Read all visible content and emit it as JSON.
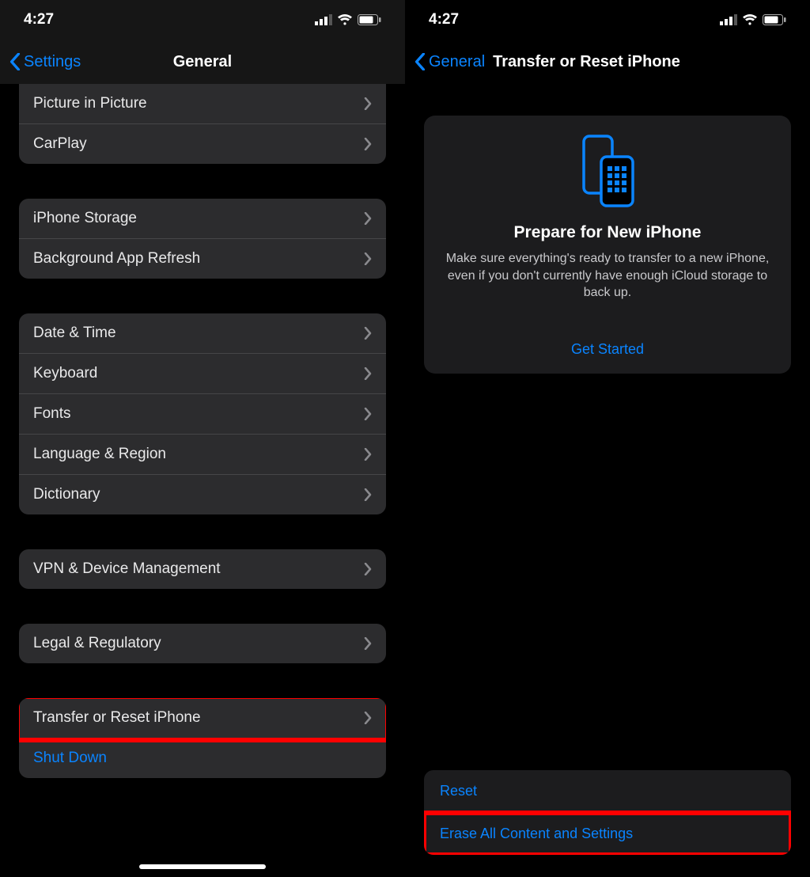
{
  "colors": {
    "accent": "#0a84ff",
    "highlight": "#ff0000"
  },
  "left": {
    "status": {
      "time": "4:27"
    },
    "nav": {
      "back": "Settings",
      "title": "General"
    },
    "groups": [
      {
        "rows": [
          {
            "label": "Picture in Picture"
          },
          {
            "label": "CarPlay"
          }
        ]
      },
      {
        "rows": [
          {
            "label": "iPhone Storage"
          },
          {
            "label": "Background App Refresh"
          }
        ]
      },
      {
        "rows": [
          {
            "label": "Date & Time"
          },
          {
            "label": "Keyboard"
          },
          {
            "label": "Fonts"
          },
          {
            "label": "Language & Region"
          },
          {
            "label": "Dictionary"
          }
        ]
      },
      {
        "rows": [
          {
            "label": "VPN & Device Management"
          }
        ]
      },
      {
        "rows": [
          {
            "label": "Legal & Regulatory"
          }
        ]
      },
      {
        "rows": [
          {
            "label": "Transfer or Reset iPhone",
            "highlight": true
          },
          {
            "label": "Shut Down",
            "blue": true,
            "noChevron": true
          }
        ]
      }
    ]
  },
  "right": {
    "status": {
      "time": "4:27"
    },
    "nav": {
      "back": "General",
      "title": "Transfer or Reset iPhone"
    },
    "card": {
      "title": "Prepare for New iPhone",
      "body": "Make sure everything's ready to transfer to a new iPhone, even if you don't currently have enough iCloud storage to back up.",
      "cta": "Get Started"
    },
    "bottom": {
      "reset": "Reset",
      "erase": "Erase All Content and Settings",
      "highlight_erase": true
    }
  }
}
